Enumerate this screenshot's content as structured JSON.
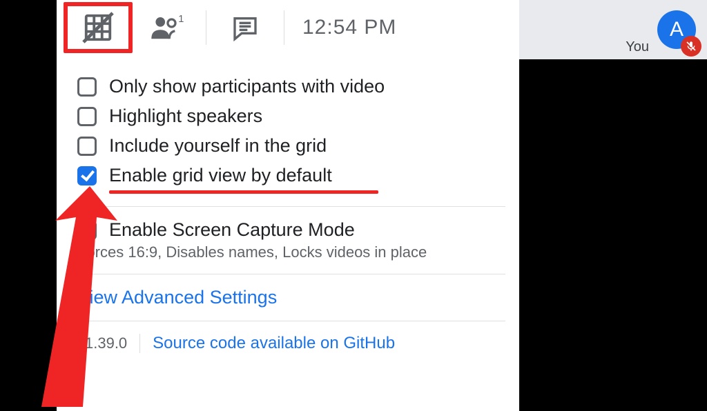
{
  "topbar": {
    "clock": "12:54 PM",
    "people_count": "1"
  },
  "options": {
    "only_video": {
      "label": "Only show participants with video",
      "checked": false
    },
    "highlight_speakers": {
      "label": "Highlight speakers",
      "checked": false
    },
    "include_self": {
      "label": "Include yourself in the grid",
      "checked": false
    },
    "enable_grid_default": {
      "label": "Enable grid view by default",
      "checked": true
    },
    "screen_capture": {
      "label": "Enable Screen Capture Mode",
      "hint": "Forces 16:9, Disables names, Locks videos in place",
      "checked": false
    }
  },
  "links": {
    "advanced": "View Advanced Settings",
    "github": "Source code available on GitHub"
  },
  "version": "v1.39.0",
  "tile": {
    "you_label": "You",
    "avatar_initial": "A"
  },
  "colors": {
    "accent": "#1a73e8",
    "highlight": "#ee2524",
    "muted_bg": "#d93025"
  }
}
